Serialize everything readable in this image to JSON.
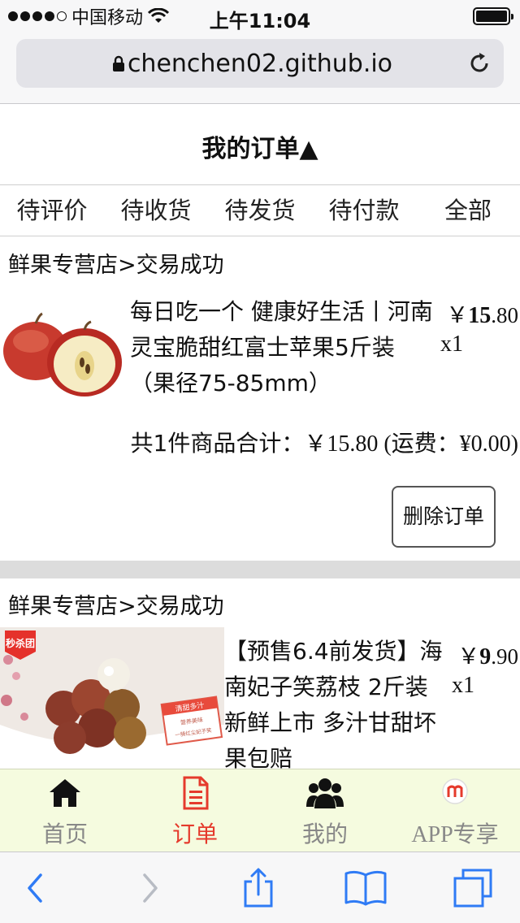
{
  "status_bar": {
    "carrier": "中国移动",
    "time": "上午11:04",
    "signal_bars": 4,
    "signal_total": 5,
    "battery_level": 1.0
  },
  "browser": {
    "url": "chenchen02.github.io"
  },
  "page": {
    "title": "我的订单▲"
  },
  "tabs": [
    {
      "label": "待评价"
    },
    {
      "label": "待收货"
    },
    {
      "label": "待发货"
    },
    {
      "label": "待付款"
    },
    {
      "label": "全部"
    }
  ],
  "orders": [
    {
      "shop": "鲜果专营店>交易成功",
      "product_name": "每日吃一个 健康好生活丨河南灵宝脆甜红富士苹果5斤装（果径75-85mm）",
      "price_symbol": "￥",
      "price_int": "15",
      "price_dec": ".80",
      "quantity": "x1",
      "summary_prefix": "共1件商品合计：",
      "summary_amount": "￥15.80 (运费：¥0.00)",
      "delete_label": "删除订单"
    },
    {
      "shop": "鲜果专营店>交易成功",
      "product_name": "【预售6.4前发货】海南妃子笑荔枝 2斤装 新鲜上市 多汁甘甜坏果包赔",
      "price_symbol": "￥",
      "price_int": "9",
      "price_dec": ".90",
      "quantity": "x1",
      "badge_text": "秒杀团",
      "sticker_title": "清甜多汁",
      "sticker_line1": "营养美味",
      "sticker_line2": "一骑红尘妃子笑"
    }
  ],
  "bottom_nav": [
    {
      "label": "首页",
      "icon": "home-icon",
      "active": false
    },
    {
      "label": "订单",
      "icon": "document-icon",
      "active": true
    },
    {
      "label": "我的",
      "icon": "users-icon",
      "active": false
    },
    {
      "label": "APP专享",
      "icon": "app-logo-icon",
      "active": false
    }
  ],
  "colors": {
    "active": "#e53a2c",
    "inactive": "#888888",
    "nav_bg": "#f5fbdf",
    "ios_blue": "#2f7bf5"
  }
}
